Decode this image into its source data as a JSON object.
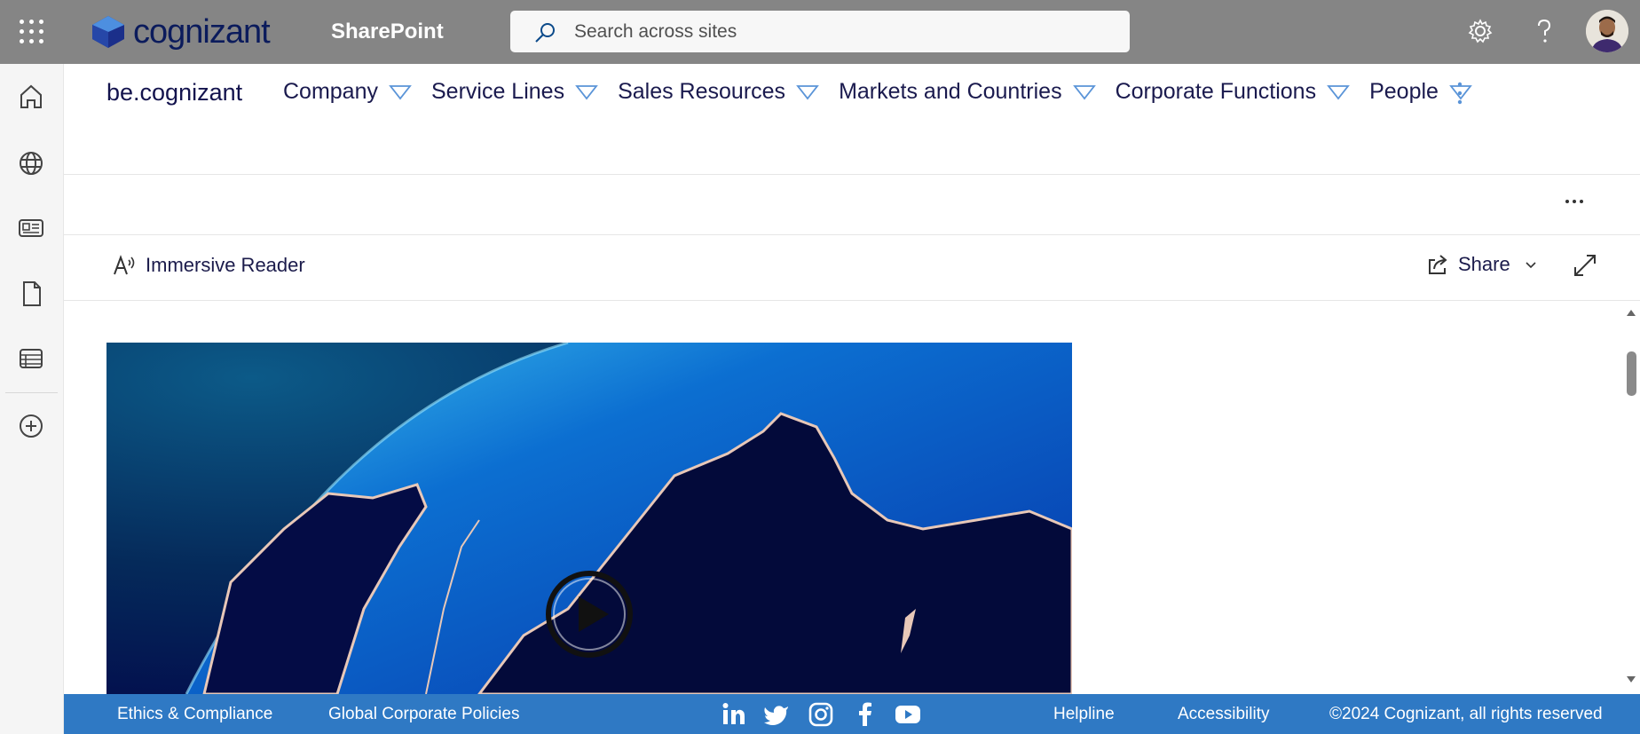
{
  "suite": {
    "logo_text": "cognizant",
    "app_name": "SharePoint",
    "search_placeholder": "Search across sites"
  },
  "hub": {
    "site_name": "be.cognizant",
    "nav": [
      {
        "label": "Company"
      },
      {
        "label": "Service Lines"
      },
      {
        "label": "Sales Resources"
      },
      {
        "label": "Markets and Countries"
      },
      {
        "label": "Corporate Functions"
      },
      {
        "label": "People"
      }
    ]
  },
  "toolbar": {
    "immersive_reader": "Immersive Reader",
    "share": "Share"
  },
  "footer": {
    "ethics": "Ethics & Compliance",
    "policies": "Global Corporate Policies",
    "helpline": "Helpline",
    "accessibility": "Accessibility",
    "copyright": "©2024 Cognizant, all rights reserved"
  },
  "colors": {
    "suitebar": "#858585",
    "footer": "#2f79c4",
    "nav_text": "#1a1a4e",
    "accent": "#2f79c4"
  }
}
